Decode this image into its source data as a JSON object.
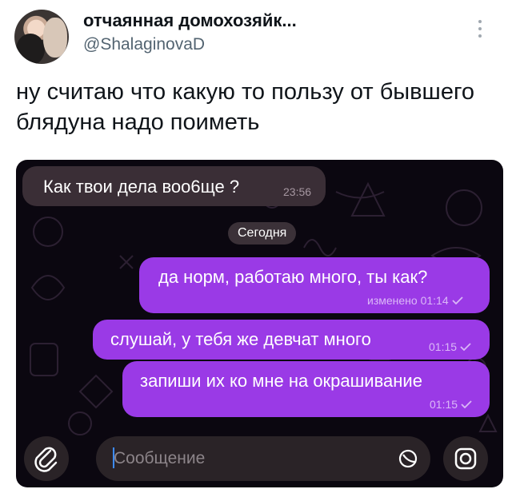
{
  "tweet": {
    "author_name": "отчаянная домохозяйк...",
    "author_handle": "@ShalaginovaD",
    "text": "ну считаю что какую то пользу от бывшего блядуна надо поиметь"
  },
  "chat": {
    "date_divider": "Сегодня",
    "messages": [
      {
        "direction": "incoming",
        "text": "Как твои дела воо6ще ?",
        "time": "23:56"
      },
      {
        "direction": "outgoing",
        "text": "да норм, работаю много, ты как?",
        "time": "изменено 01:14"
      },
      {
        "direction": "outgoing",
        "text": "слушай, у тебя же девчат много",
        "time": "01:15"
      },
      {
        "direction": "outgoing",
        "text": "запиши их ко мне на окрашивание",
        "time": "01:15"
      }
    ],
    "input_placeholder": "Сообщение",
    "icons": {
      "attach": "paperclip-icon",
      "sticker": "sticker-icon",
      "camera": "camera-icon",
      "more": "more-vertical-icon",
      "read": "checkmark-icon"
    },
    "colors": {
      "outgoing_bubble": "#9a3ae6",
      "incoming_bubble": "#3a2e36",
      "background": "#0b0710"
    }
  }
}
